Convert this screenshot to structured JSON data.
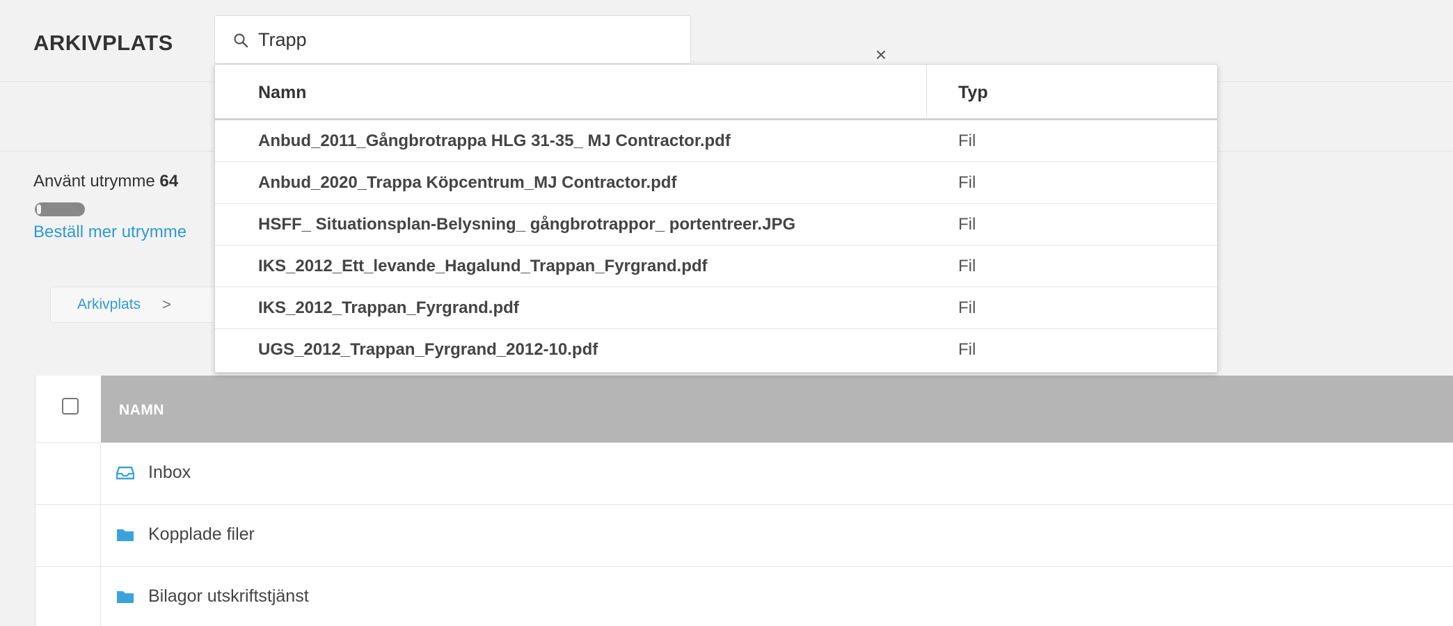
{
  "header": {
    "title": "ARKIVPLATS",
    "search": {
      "value": "Trapp",
      "placeholder": ""
    }
  },
  "storage": {
    "label_prefix": "Använt utrymme ",
    "label_value": "64",
    "usage_fraction": 0.08,
    "order_link": "Beställ mer utrymme"
  },
  "breadcrumb": {
    "item": "Arkivplats",
    "separator": ">"
  },
  "table": {
    "column_name": "NAMN",
    "rows": [
      {
        "label": "Inbox",
        "icon": "inbox-icon"
      },
      {
        "label": "Kopplade filer",
        "icon": "folder-icon"
      },
      {
        "label": "Bilagor utskriftstjänst",
        "icon": "folder-icon"
      }
    ]
  },
  "search_results": {
    "columns": {
      "name": "Namn",
      "type": "Typ"
    },
    "items": [
      {
        "name": "Anbud_2011_Gångbrotrappa HLG 31-35_ MJ Contractor.pdf",
        "type": "Fil"
      },
      {
        "name": "Anbud_2020_Trappa Köpcentrum_MJ Contractor.pdf",
        "type": "Fil"
      },
      {
        "name": "HSFF_ Situationsplan-Belysning_ gångbrotrappor_ portentreer.JPG",
        "type": "Fil"
      },
      {
        "name": "IKS_2012_Ett_levande_Hagalund_Trappan_Fyrgrand.pdf",
        "type": "Fil"
      },
      {
        "name": "IKS_2012_Trappan_Fyrgrand.pdf",
        "type": "Fil"
      },
      {
        "name": "UGS_2012_Trappan_Fyrgrand_2012-10.pdf",
        "type": "Fil"
      }
    ]
  },
  "colors": {
    "accent": "#2e9bd6",
    "header_bg": "#b5b5b5",
    "page_bg": "#f2f2f2"
  }
}
